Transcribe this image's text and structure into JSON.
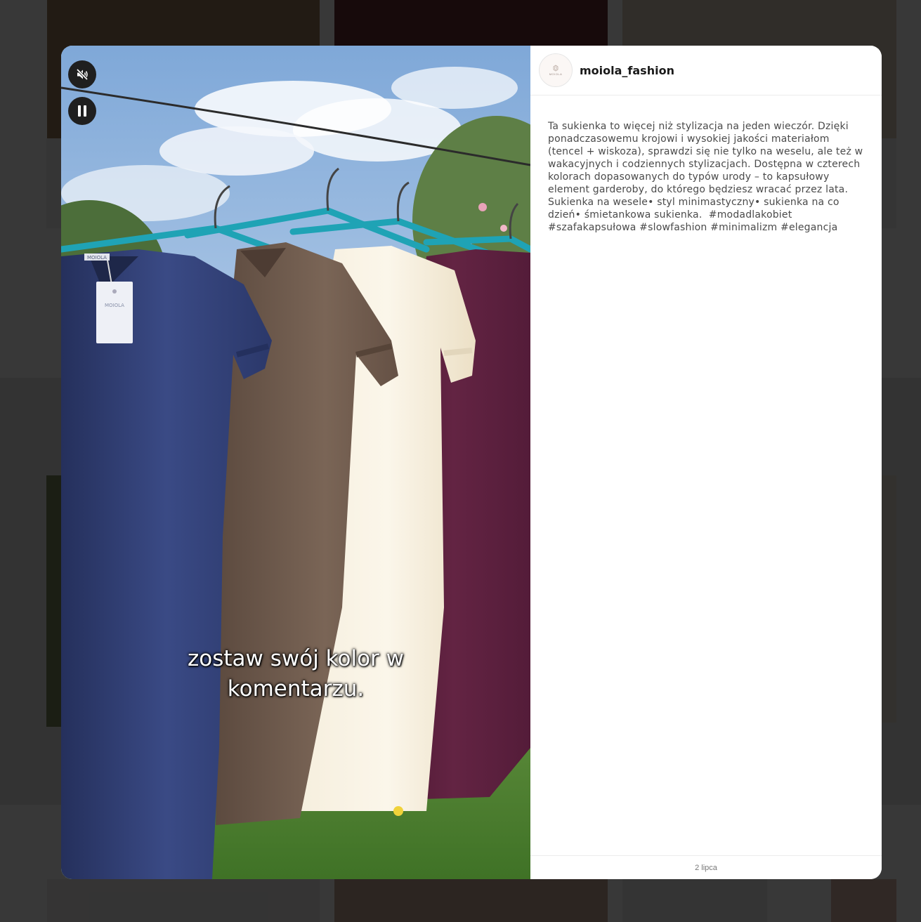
{
  "post": {
    "username": "moiola_fashion",
    "avatar_logo": "MOIOLA",
    "description": "Ta sukienka to więcej niż stylizacja na jeden wieczór. Dzięki ponadczasowemu krojowi i wysokiej jakości materiałom (tencel + wiskoza), sprawdzi się nie tylko na weselu, ale też w wakacyjnych i codziennych stylizacjach. Dostępna w czterech kolorach dopasowanych do typów urody – to kapsułowy element garderoby, do którego będziesz wracać przez lata. Sukienka na wesele• styl minimastyczny• sukienka na co dzień• śmietankowa sukienka.  #modadlakobiet #szafakapsułowa #slowfashion #minimalizm #elegancja",
    "date": "2 lipca"
  },
  "video": {
    "caption_line1": "zostaw swój kolor w",
    "caption_line2": "komentarzu.",
    "tag_brand": "MOIOLA",
    "muted": true,
    "playing": true,
    "mute_icon": "volume-off-icon",
    "pause_icon": "pause-icon"
  },
  "colors": {
    "overlay": "#000000",
    "hanger": "#1fa3b5",
    "dress_navy": "#2d3b6e",
    "dress_brown": "#6f5a4c",
    "dress_cream": "#f3ead8",
    "dress_plum": "#5a1f3a"
  }
}
